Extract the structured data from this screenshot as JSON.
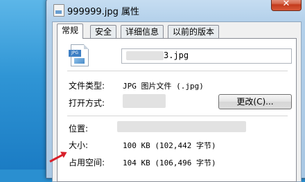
{
  "window": {
    "title": "999999.jpg 属性",
    "close_glyph": "✕"
  },
  "tabs": [
    {
      "label": "常规",
      "active": true
    },
    {
      "label": "安全",
      "active": false
    },
    {
      "label": "详细信息",
      "active": false
    },
    {
      "label": "以前的版本",
      "active": false
    }
  ],
  "file": {
    "icon_tag": "JPG",
    "name_visible": "3.jpg"
  },
  "properties": {
    "type_label": "文件类型:",
    "type_value": "JPG 图片文件 (.jpg)",
    "open_with_label": "打开方式:",
    "change_button": "更改(C)...",
    "location_label": "位置:",
    "size_label": "大小:",
    "size_value": "100 KB (102,442 字节)",
    "disk_size_label": "占用空间:",
    "disk_size_value": "104 KB (106,496 字节)"
  },
  "colors": {
    "desktop": "#2f95d5",
    "close_button": "#c43b1c",
    "arrow": "#d8202a"
  }
}
